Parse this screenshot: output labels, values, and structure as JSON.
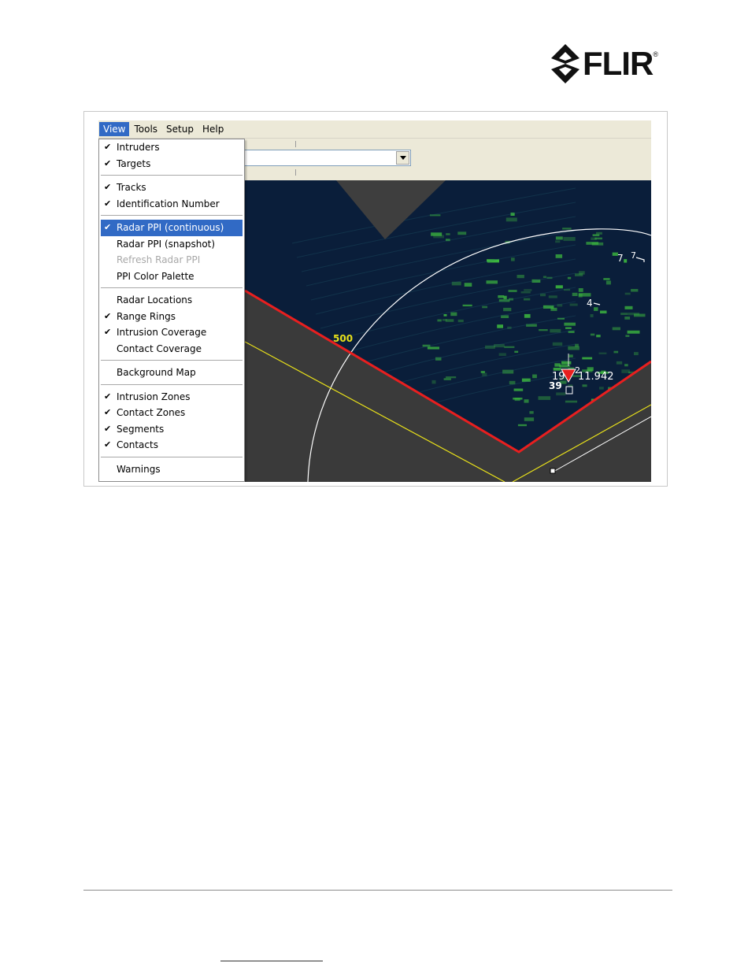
{
  "brand": {
    "name": "FLIR",
    "reg": "®"
  },
  "menubar": {
    "items": [
      {
        "id": "view",
        "label": "View"
      },
      {
        "id": "tools",
        "label": "Tools"
      },
      {
        "id": "setup",
        "label": "Setup"
      },
      {
        "id": "help",
        "label": "Help"
      }
    ]
  },
  "view_menu": {
    "groups": [
      [
        {
          "label": "Intruders",
          "checked": true
        },
        {
          "label": "Targets",
          "checked": true
        }
      ],
      [
        {
          "label": "Tracks",
          "checked": true
        },
        {
          "label": "Identification Number",
          "checked": true
        }
      ],
      [
        {
          "label": "Radar PPI (continuous)",
          "checked": true,
          "highlighted": true
        },
        {
          "label": "Radar PPI (snapshot)",
          "checked": false
        },
        {
          "label": "Refresh Radar PPI",
          "checked": false,
          "disabled": true
        },
        {
          "label": "PPI Color Palette",
          "checked": false
        }
      ],
      [
        {
          "label": "Radar Locations",
          "checked": false
        },
        {
          "label": "Range Rings",
          "checked": true
        },
        {
          "label": "Intrusion Coverage",
          "checked": true
        },
        {
          "label": "Contact Coverage",
          "checked": false
        }
      ],
      [
        {
          "label": "Background Map",
          "checked": false
        }
      ],
      [
        {
          "label": "Intrusion Zones",
          "checked": true
        },
        {
          "label": "Contact Zones",
          "checked": true
        },
        {
          "label": "Segments",
          "checked": true
        },
        {
          "label": "Contacts",
          "checked": true
        }
      ],
      [
        {
          "label": "Warnings",
          "checked": false
        }
      ]
    ]
  },
  "radar": {
    "range_ring_label": "500",
    "track_labels": [
      "7",
      "7",
      "4",
      "19",
      "2",
      "11.942",
      "39"
    ],
    "colors": {
      "background": "#0a1e3a",
      "echo": "#3fbf3f",
      "coverage_edge": "#e81f1f",
      "ring": "#ffffff",
      "zone": "#e8e01a",
      "outside": "#3a3a3a"
    }
  },
  "icons": {
    "check": "✔"
  }
}
